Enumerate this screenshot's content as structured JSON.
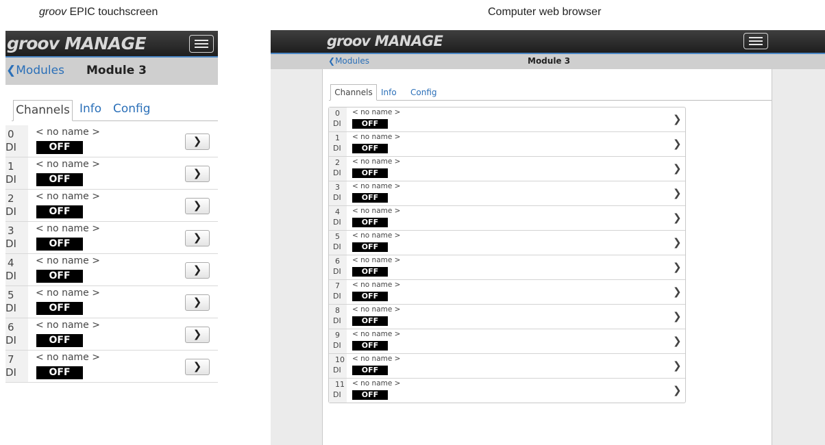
{
  "captions": {
    "left_prefix": "groov",
    "left_suffix": " EPIC touchscreen",
    "right": "Computer web browser"
  },
  "app": {
    "logo_left": "groov",
    "logo_right": "MANAGE",
    "menu_icon": "hamburger-menu-icon"
  },
  "subnav": {
    "back_label": "Modules",
    "back_icon": "chevron-left-icon",
    "module_title": "Module 3"
  },
  "tabs": [
    "Channels",
    "Info",
    "Config"
  ],
  "channels": [
    {
      "num": "0",
      "type": "DI",
      "name": "< no name >",
      "state": "OFF"
    },
    {
      "num": "1",
      "type": "DI",
      "name": "< no name >",
      "state": "OFF"
    },
    {
      "num": "2",
      "type": "DI",
      "name": "< no name >",
      "state": "OFF"
    },
    {
      "num": "3",
      "type": "DI",
      "name": "< no name >",
      "state": "OFF"
    },
    {
      "num": "4",
      "type": "DI",
      "name": "< no name >",
      "state": "OFF"
    },
    {
      "num": "5",
      "type": "DI",
      "name": "< no name >",
      "state": "OFF"
    },
    {
      "num": "6",
      "type": "DI",
      "name": "< no name >",
      "state": "OFF"
    },
    {
      "num": "7",
      "type": "DI",
      "name": "< no name >",
      "state": "OFF"
    },
    {
      "num": "8",
      "type": "DI",
      "name": "< no name >",
      "state": "OFF"
    },
    {
      "num": "9",
      "type": "DI",
      "name": "< no name >",
      "state": "OFF"
    },
    {
      "num": "10",
      "type": "DI",
      "name": "< no name >",
      "state": "OFF"
    },
    {
      "num": "11",
      "type": "DI",
      "name": "< no name >",
      "state": "OFF"
    }
  ],
  "touchscreen_visible_rows": 8,
  "colors": {
    "accent": "#2a6fb8",
    "bar": "#2b2b2b",
    "subnav": "#cfcfcf",
    "badge": "#000000"
  }
}
